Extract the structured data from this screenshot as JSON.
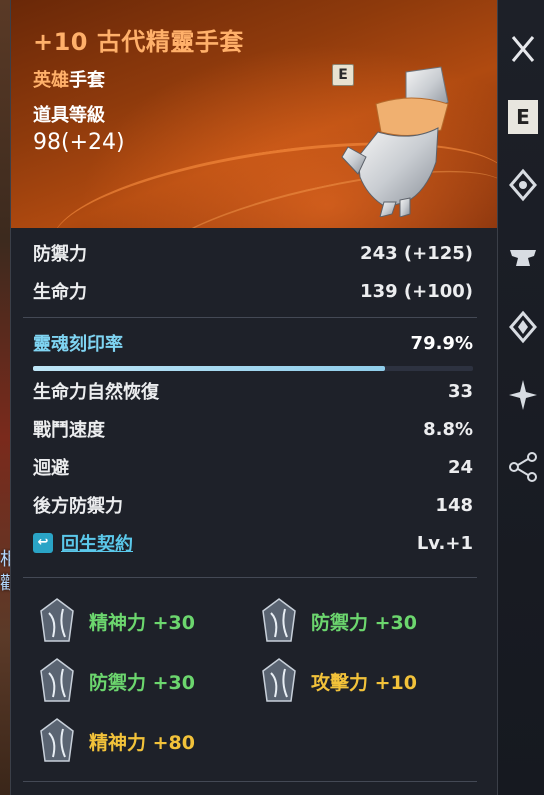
{
  "item": {
    "name": "+10 古代精靈手套",
    "rarity": "英雄",
    "slot": "手套",
    "level_label": "道具等級",
    "level_value": "98(+24)",
    "equip_badge": "E"
  },
  "stats": [
    {
      "label": "防禦力",
      "value": "243 (+125)"
    },
    {
      "label": "生命力",
      "value": "139 (+100)"
    }
  ],
  "soul": {
    "label": "靈魂刻印率",
    "value": "79.9%",
    "progress": 0.799
  },
  "sub_stats": [
    {
      "label": "生命力自然恢復",
      "value": "33"
    },
    {
      "label": "戰鬥速度",
      "value": "8.8%"
    },
    {
      "label": "迴避",
      "value": "24"
    },
    {
      "label": "後方防禦力",
      "value": "148"
    }
  ],
  "rebirth": {
    "label": "回生契約",
    "value": "Lv.+1"
  },
  "bonuses": [
    {
      "label": "精神力",
      "value": "+30",
      "color": "#6cd66e"
    },
    {
      "label": "防禦力",
      "value": "+30",
      "color": "#6cd66e"
    },
    {
      "label": "防禦力",
      "value": "+30",
      "color": "#6cd66e"
    },
    {
      "label": "攻擊力",
      "value": "+10",
      "color": "#f2c23a"
    },
    {
      "label": "精神力",
      "value": "+80",
      "color": "#f2c23a"
    }
  ],
  "side_menu": {
    "badge": "E",
    "icons": [
      "close-icon",
      "equip-badge-icon",
      "enhance-icon",
      "anvil-icon",
      "soul-icon",
      "star-burst-icon",
      "share-icon"
    ]
  },
  "background_text": "相\n觀"
}
